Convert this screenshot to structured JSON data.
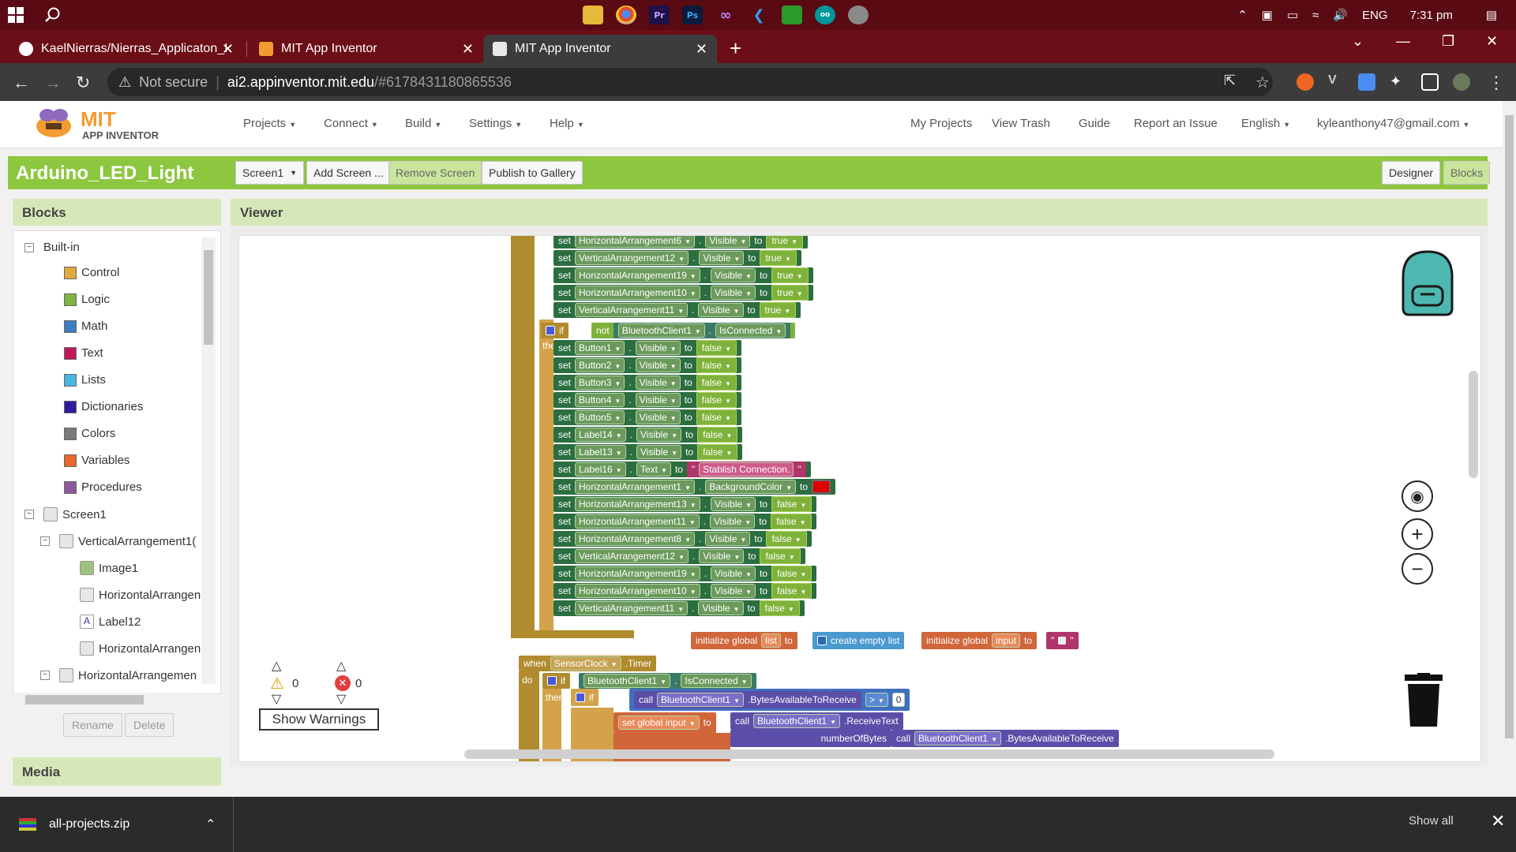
{
  "taskbar": {
    "lang": "ENG",
    "time": "7:31 pm"
  },
  "tabs": [
    {
      "title": "KaelNierras/Nierras_Applicaton_I"
    },
    {
      "title": "MIT App Inventor"
    },
    {
      "title": "MIT App Inventor"
    }
  ],
  "address": {
    "security": "Not secure",
    "host": "ai2.appinventor.mit.edu",
    "path": "/#6178431180865536"
  },
  "header": {
    "logo_mit": "MIT",
    "logo_sub": "APP INVENTOR",
    "menus": [
      "Projects",
      "Connect",
      "Build",
      "Settings",
      "Help"
    ],
    "links": [
      "My Projects",
      "View Trash",
      "Guide",
      "Report an Issue",
      "English",
      "kyleanthony47@gmail.com"
    ]
  },
  "project": {
    "name": "Arduino_LED_Light",
    "screen": "Screen1",
    "add_screen": "Add Screen ...",
    "remove_screen": "Remove Screen",
    "publish": "Publish to Gallery",
    "designer": "Designer",
    "blocks": "Blocks"
  },
  "blocks_panel": {
    "title": "Blocks",
    "builtin": "Built-in",
    "categories": [
      {
        "label": "Control",
        "color": "#e0a93b"
      },
      {
        "label": "Logic",
        "color": "#7cb342"
      },
      {
        "label": "Math",
        "color": "#3f7dc1"
      },
      {
        "label": "Text",
        "color": "#c2185b"
      },
      {
        "label": "Lists",
        "color": "#4ab6e4"
      },
      {
        "label": "Dictionaries",
        "color": "#2d1a9c"
      },
      {
        "label": "Colors",
        "color": "#7a7a7a"
      },
      {
        "label": "Variables",
        "color": "#e56a2c"
      },
      {
        "label": "Procedures",
        "color": "#8e5a9e"
      }
    ],
    "components": [
      "Screen1",
      "VerticalArrangement1(",
      "Image1",
      "HorizontalArrangen",
      "Label12",
      "HorizontalArrangen",
      "HorizontalArrangemen"
    ],
    "rename": "Rename",
    "delete": "Delete"
  },
  "viewer": {
    "title": "Viewer",
    "warnings_count": "0",
    "errors_count": "0",
    "show_warnings": "Show Warnings"
  },
  "blocks": {
    "set": "set",
    "to": "to",
    "dot": ".",
    "true": "true",
    "false": "false",
    "visible": "Visible",
    "if": "if",
    "then": "then",
    "not": "not",
    "when": "when",
    "do": "do",
    "call": "call",
    "bt_client": "BluetoothClient1",
    "is_connected": "IsConnected",
    "top_rows": [
      {
        "comp": "HorizontalArrangement6",
        "prop": "Visible",
        "val": "true"
      },
      {
        "comp": "VerticalArrangement12",
        "prop": "Visible",
        "val": "true"
      },
      {
        "comp": "HorizontalArrangement19",
        "prop": "Visible",
        "val": "true"
      },
      {
        "comp": "HorizontalArrangement10",
        "prop": "Visible",
        "val": "true"
      },
      {
        "comp": "VerticalArrangement11",
        "prop": "Visible",
        "val": "true"
      }
    ],
    "then_rows": [
      {
        "comp": "Button1",
        "prop": "Visible",
        "val": "false"
      },
      {
        "comp": "Button2",
        "prop": "Visible",
        "val": "false"
      },
      {
        "comp": "Button3",
        "prop": "Visible",
        "val": "false"
      },
      {
        "comp": "Button4",
        "prop": "Visible",
        "val": "false"
      },
      {
        "comp": "Button5",
        "prop": "Visible",
        "val": "false"
      },
      {
        "comp": "Label14",
        "prop": "Visible",
        "val": "false"
      },
      {
        "comp": "Label13",
        "prop": "Visible",
        "val": "false"
      },
      {
        "comp": "Label16",
        "prop": "Text",
        "val": "Stablish Connection.",
        "kind": "text"
      },
      {
        "comp": "HorizontalArrangement1",
        "prop": "BackgroundColor",
        "val": "",
        "kind": "color"
      },
      {
        "comp": "HorizontalArrangement13",
        "prop": "Visible",
        "val": "false"
      },
      {
        "comp": "HorizontalArrangement11",
        "prop": "Visible",
        "val": "false"
      },
      {
        "comp": "HorizontalArrangement8",
        "prop": "Visible",
        "val": "false"
      },
      {
        "comp": "VerticalArrangement12",
        "prop": "Visible",
        "val": "false"
      },
      {
        "comp": "HorizontalArrangement19",
        "prop": "Visible",
        "val": "false"
      },
      {
        "comp": "HorizontalArrangement10",
        "prop": "Visible",
        "val": "false"
      },
      {
        "comp": "VerticalArrangement11",
        "prop": "Visible",
        "val": "false"
      }
    ],
    "init_list": {
      "label": "initialize global",
      "name": "list",
      "to": "to",
      "value": "create empty list"
    },
    "init_input": {
      "label": "initialize global",
      "name": "input",
      "to": "to"
    },
    "timer": {
      "comp": "SensorClock",
      "event": ".Timer"
    },
    "bytes_available": ".BytesAvailableToReceive",
    "compare_op": ">",
    "compare_num": "0",
    "set_global_input": "set global input",
    "receive_text": ".ReceiveText",
    "number_of_bytes": "numberOfBytes",
    "bytes_available2": ".BytesAvailableToReceive"
  },
  "media": {
    "title": "Media"
  },
  "download": {
    "file": "all-projects.zip",
    "show_all": "Show all"
  }
}
